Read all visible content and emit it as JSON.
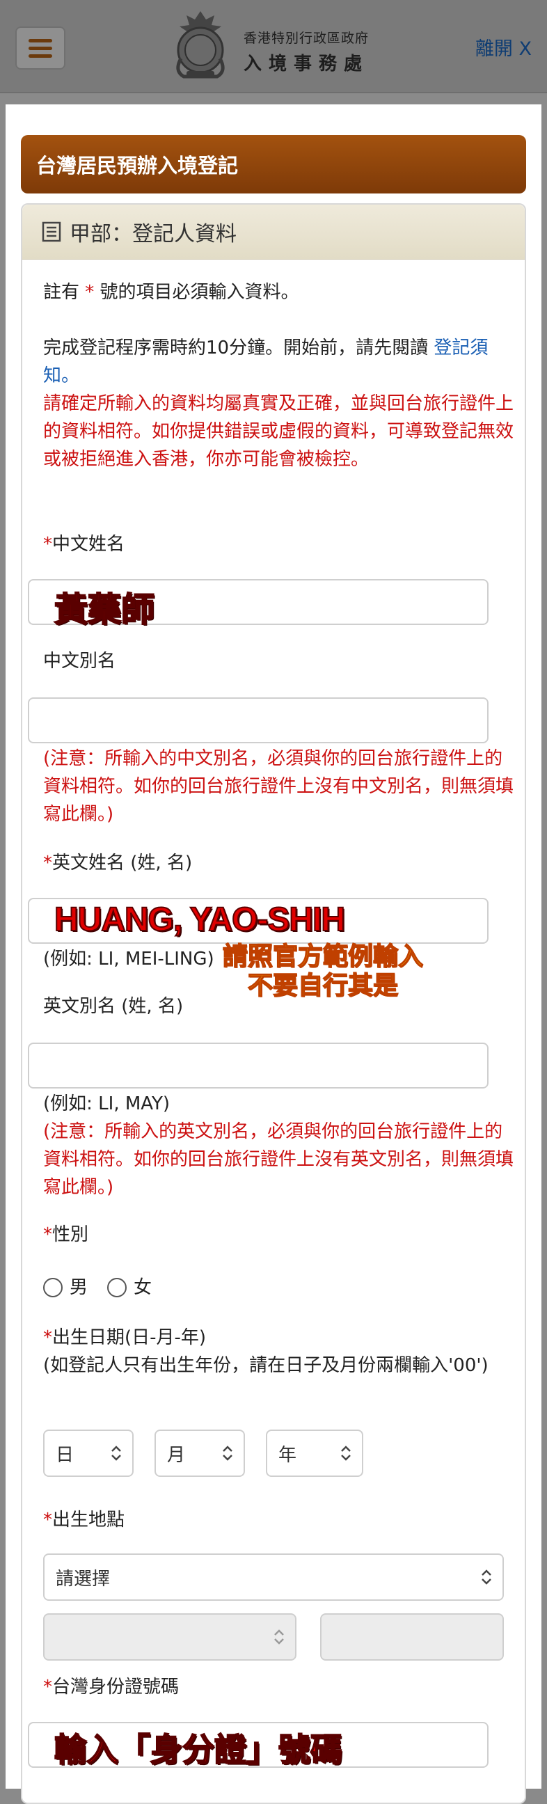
{
  "header": {
    "dept_line1": "香港特別行政區政府",
    "dept_line2": "入境事務處",
    "exit_label": "離開 X"
  },
  "form": {
    "title": "台灣居民預辦入境登記",
    "section_title": "甲部：登記人資料",
    "note_required_prefix": "註有 ",
    "note_required_star": "*",
    "note_required_suffix": " 號的項目必須輸入資料。",
    "intro_time": "完成登記程序需時約10分鐘。開始前，請先閱讀 ",
    "intro_link": "登記須知",
    "intro_period": "。",
    "warning": "請確定所輸入的資料均屬真實及正確，並與回台旅行證件上的資料相符。如你提供錯誤或虛假的資料，可導致登記無效或被拒絕進入香港，你亦可能會被檢控。",
    "chinese_name_label": "中文姓名",
    "chinese_alias_label": "中文別名",
    "chinese_alias_note": "(注意：所輸入的中文別名，必須與你的回台旅行證件上的資料相符。如你的回台旅行證件上沒有中文別名，則無須填寫此欄。)",
    "english_name_label": "英文姓名 (姓, 名)",
    "english_name_example": "(例如: LI, MEI-LING)",
    "english_alias_label": "英文別名 (姓, 名)",
    "english_alias_example": "(例如: LI, MAY)",
    "english_alias_note": "(注意：所輸入的英文別名，必須與你的回台旅行證件上的資料相符。如你的回台旅行證件上沒有英文別名，則無須填寫此欄。)",
    "gender_label": "性別",
    "gender_male": "男",
    "gender_female": "女",
    "dob_label": "出生日期(日-月-年)",
    "dob_note": "(如登記人只有出生年份，請在日子及月份兩欄輸入'00')",
    "dob_day": "日",
    "dob_month": "月",
    "dob_year": "年",
    "birthplace_label": "出生地點",
    "birthplace_placeholder": "請選擇",
    "taiwan_id_label": "台灣身份證號碼",
    "required_star": "*"
  },
  "annotations": {
    "chinese_name_value": "黃藥師",
    "english_name_value": "HUANG, YAO-SHIH",
    "english_hint_line1": "請照官方範例輸入",
    "english_hint_line2": "不要自行其是",
    "taiwan_id_hint": "輸入「身分證」號碼"
  }
}
